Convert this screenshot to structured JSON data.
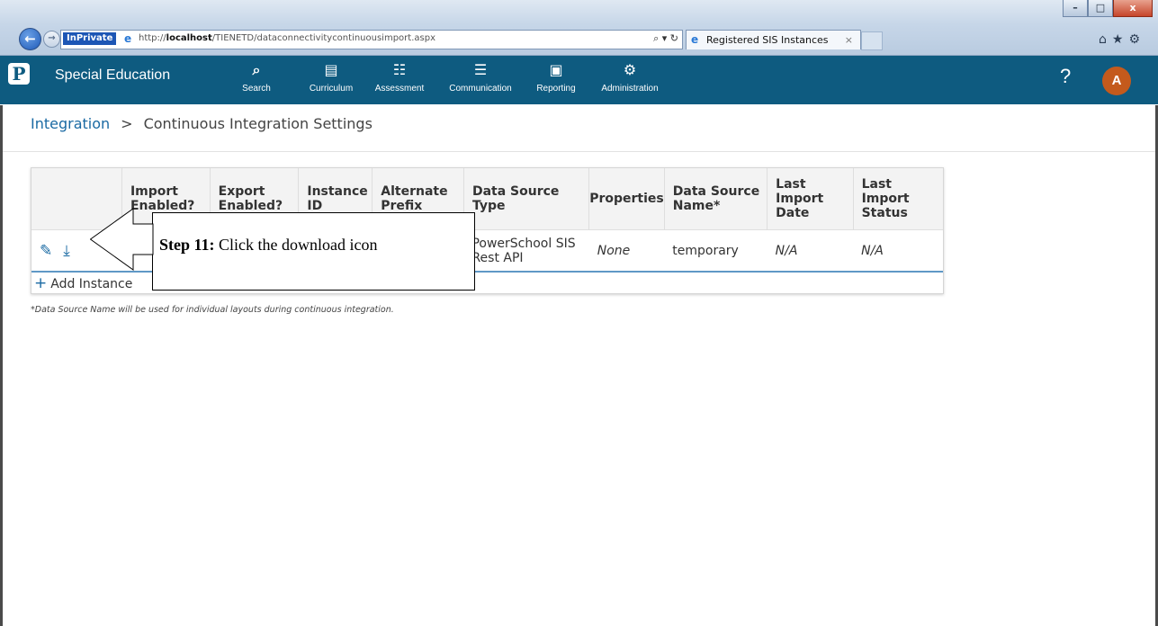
{
  "browser": {
    "inprivate_label": "InPrivate",
    "url_prefix": "http://",
    "url_host": "localhost",
    "url_path": "/TIENETD/dataconnectivitycontinuousimport.aspx",
    "address_controls": "⌕ ▾ ↻",
    "tab_title": "Registered SIS Instances",
    "tab_close": "×",
    "tools": "⌂★⚙",
    "minimize": "–",
    "maximize": "□",
    "close": "x"
  },
  "app": {
    "title": "Special Education",
    "logo": "P",
    "nav": [
      {
        "label": "Search",
        "icon": "⌕"
      },
      {
        "label": "Curriculum",
        "icon": "▤"
      },
      {
        "label": "Assessment",
        "icon": "☷"
      },
      {
        "label": "Communication",
        "icon": "☰"
      },
      {
        "label": "Reporting",
        "icon": "▣"
      },
      {
        "label": "Administration",
        "icon": "⚙"
      }
    ],
    "help": "?",
    "avatar": "A"
  },
  "breadcrumb": {
    "root": "Integration",
    "separator": ">",
    "current": "Continuous Integration Settings"
  },
  "table": {
    "headers": [
      "",
      "Import Enabled?",
      "Export Enabled?",
      "Instance ID",
      "Alternate Prefix",
      "Data Source Type",
      "Properties",
      "Data Source Name*",
      "Last Import Date",
      "Last Import Status"
    ],
    "row": {
      "data_source_type": "PowerSchool SIS Rest API",
      "properties": "None",
      "data_source_name": "temporary",
      "last_import_date": "N/A",
      "last_import_status": "N/A"
    },
    "edit_icon": "✎",
    "download_icon": "⤓",
    "add_instance": "Add Instance",
    "add_icon": "+"
  },
  "note": "*Data Source Name will be used for individual layouts during continuous integration.",
  "callout": {
    "step": "Step 11:",
    "text": " Click the download icon"
  }
}
